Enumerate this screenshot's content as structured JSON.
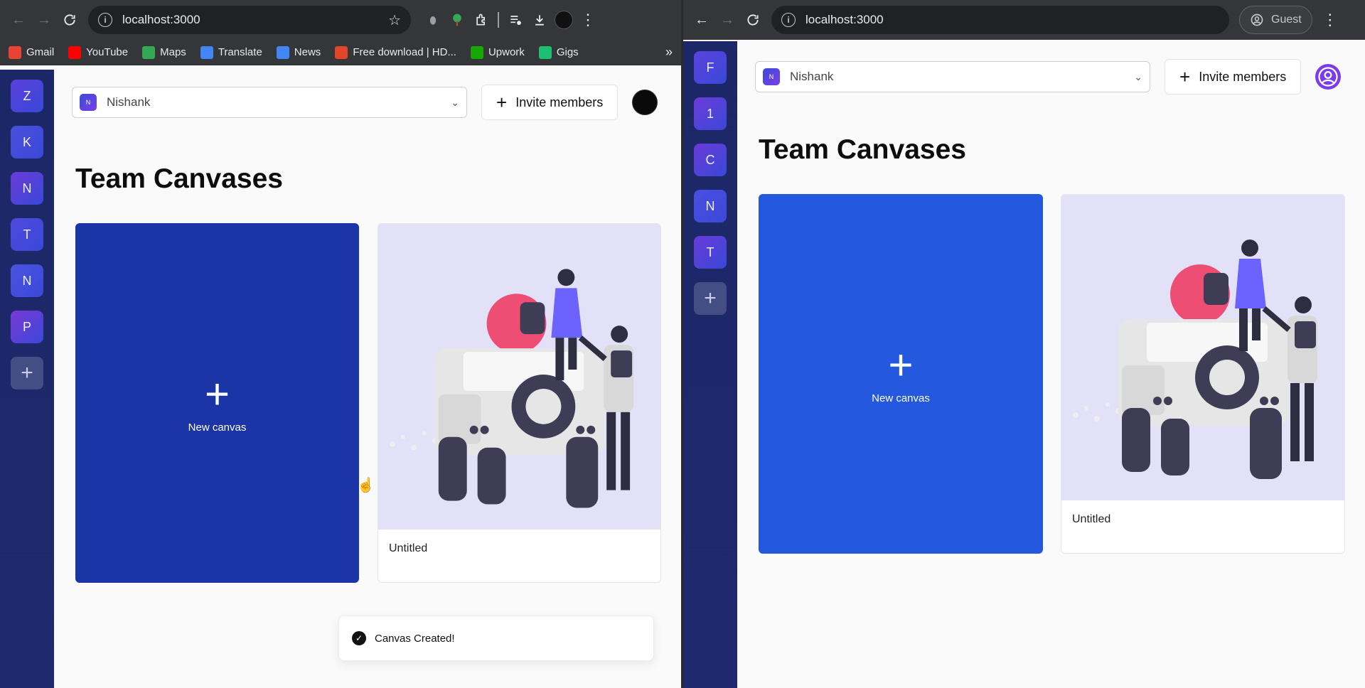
{
  "left_browser": {
    "url": "localhost:3000",
    "bookmarks": [
      {
        "label": "Gmail",
        "icon": "gmail-icon",
        "color": "#ea4335"
      },
      {
        "label": "YouTube",
        "icon": "youtube-icon",
        "color": "#ff0000"
      },
      {
        "label": "Maps",
        "icon": "maps-icon",
        "color": "#34a853"
      },
      {
        "label": "Translate",
        "icon": "translate-icon",
        "color": "#4285f4"
      },
      {
        "label": "News",
        "icon": "news-icon",
        "color": "#4285f4"
      },
      {
        "label": "Free download | HD...",
        "icon": "freepik-icon",
        "color": "#e2452a"
      },
      {
        "label": "Upwork",
        "icon": "upwork-icon",
        "color": "#14a800"
      },
      {
        "label": "Gigs",
        "icon": "fiverr-icon",
        "color": "#1dbf73"
      }
    ],
    "bookmarks_more": "»"
  },
  "right_browser": {
    "url": "localhost:3000",
    "profile_label": "Guest"
  },
  "left_app": {
    "orgs": [
      {
        "initial": "Z",
        "color": "#5b3fd9"
      },
      {
        "initial": "K",
        "color": "#4a4fdc"
      },
      {
        "initial": "N",
        "color": "#6a3ad8"
      },
      {
        "initial": "T",
        "color": "#4f49dd"
      },
      {
        "initial": "N",
        "color": "#4b53e0"
      },
      {
        "initial": "P",
        "color": "#7a38d6"
      }
    ],
    "switcher_badge": "N",
    "switcher_label": "Nishank",
    "invite_label": "Invite members",
    "heading": "Team Canvases",
    "new_canvas_label": "New canvas",
    "new_canvas_color": "#1b34a6",
    "board_title": "Untitled",
    "toast_message": "Canvas Created!"
  },
  "right_app": {
    "orgs": [
      {
        "initial": "F",
        "color": "#5a42dc"
      },
      {
        "initial": "1",
        "color": "#6d3bd8"
      },
      {
        "initial": "C",
        "color": "#6a3ad8"
      },
      {
        "initial": "N",
        "color": "#4b4fe0"
      },
      {
        "initial": "T",
        "color": "#6a3ad8"
      }
    ],
    "switcher_badge": "N",
    "switcher_label": "Nishank",
    "invite_label": "Invite members",
    "heading": "Team Canvases",
    "new_canvas_label": "New canvas",
    "new_canvas_color": "#2458df",
    "board_title": "Untitled"
  }
}
